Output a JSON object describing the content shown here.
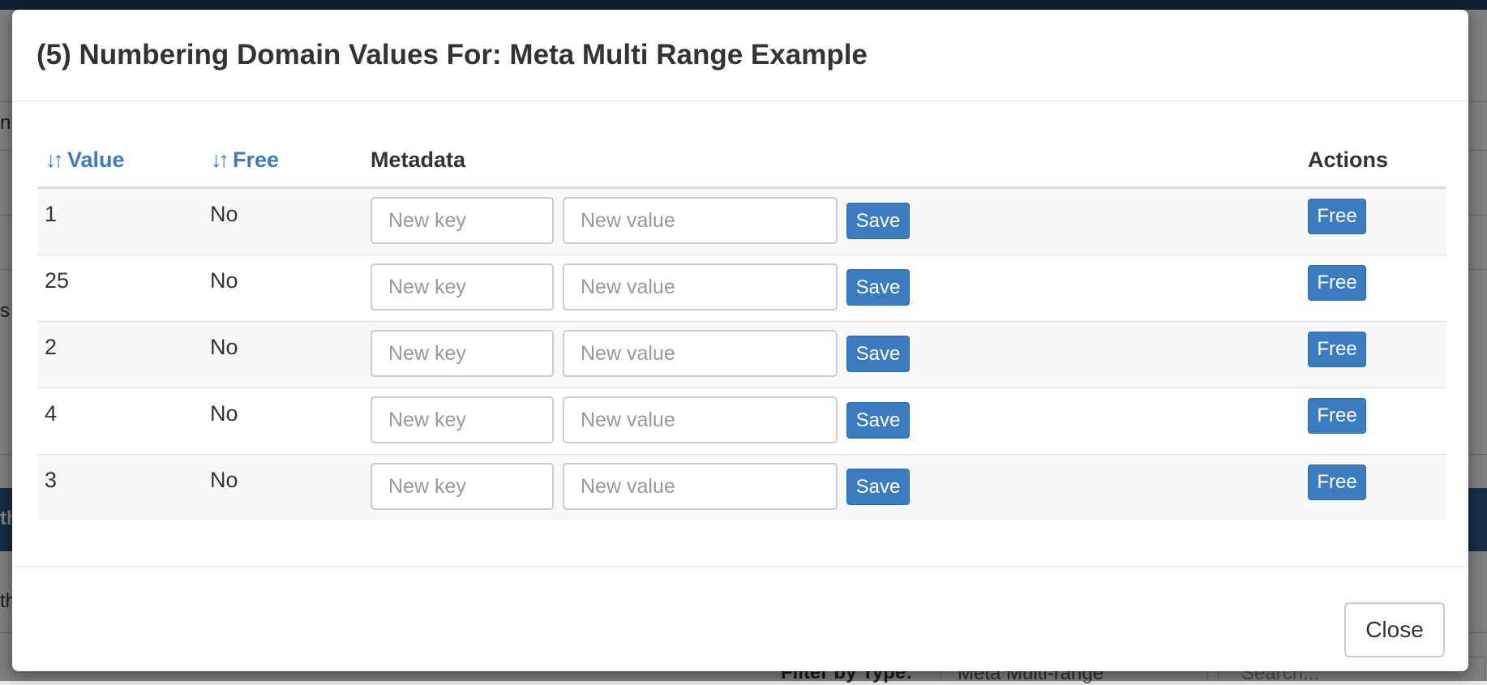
{
  "background": {
    "fragment_1": "n",
    "fragment_2": "s",
    "fragment_3": "th",
    "fragment_4": "th",
    "filter_label": "Filter by Type:",
    "filter_select_value": "Meta Multi-range",
    "search_placeholder": "Search..."
  },
  "modal": {
    "title": "(5) Numbering Domain Values For: Meta Multi Range Example",
    "columns": {
      "value": "Value",
      "free": "Free",
      "metadata": "Metadata",
      "actions": "Actions"
    },
    "sort_icon": "sort-icon",
    "rows": [
      {
        "value": "1",
        "free": "No",
        "key_placeholder": "New key",
        "value_placeholder": "New value",
        "save_label": "Save",
        "free_label": "Free"
      },
      {
        "value": "25",
        "free": "No",
        "key_placeholder": "New key",
        "value_placeholder": "New value",
        "save_label": "Save",
        "free_label": "Free"
      },
      {
        "value": "2",
        "free": "No",
        "key_placeholder": "New key",
        "value_placeholder": "New value",
        "save_label": "Save",
        "free_label": "Free"
      },
      {
        "value": "4",
        "free": "No",
        "key_placeholder": "New key",
        "value_placeholder": "New value",
        "save_label": "Save",
        "free_label": "Free"
      },
      {
        "value": "3",
        "free": "No",
        "key_placeholder": "New key",
        "value_placeholder": "New value",
        "save_label": "Save",
        "free_label": "Free"
      }
    ],
    "close_label": "Close"
  },
  "colors": {
    "primary_button": "#3a7cbf",
    "link": "#3a7cbf",
    "header_bar": "#1f3f66",
    "band": "#2a5a8c"
  }
}
